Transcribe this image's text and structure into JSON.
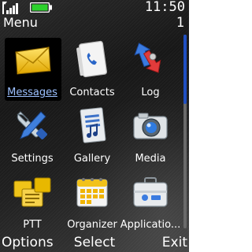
{
  "status_bar": {
    "time": "11:50",
    "signal_icon": "signal-bars-icon",
    "battery_icon": "battery-full-icon",
    "battery_color": "#2bd12b"
  },
  "header": {
    "title": "Menu",
    "page_indicator": "1"
  },
  "scrollbar": {
    "thumb_color": "#1f4fc2",
    "position": 0
  },
  "menu": {
    "selected_index": 0,
    "items": [
      {
        "label": "Messages",
        "icon": "envelope-icon"
      },
      {
        "label": "Contacts",
        "icon": "phone-book-icon"
      },
      {
        "label": "Log",
        "icon": "call-log-arrows-icon"
      },
      {
        "label": "Settings",
        "icon": "wrench-tools-icon"
      },
      {
        "label": "Gallery",
        "icon": "music-media-file-icon"
      },
      {
        "label": "Media",
        "icon": "camera-icon"
      },
      {
        "label": "PTT",
        "icon": "push-to-talk-icon"
      },
      {
        "label": "Organizer",
        "icon": "calendar-icon"
      },
      {
        "label": "Applicatio...",
        "icon": "applications-briefcase-icon"
      }
    ]
  },
  "softkeys": {
    "left": "Options",
    "middle": "Select",
    "right": "Exit"
  }
}
